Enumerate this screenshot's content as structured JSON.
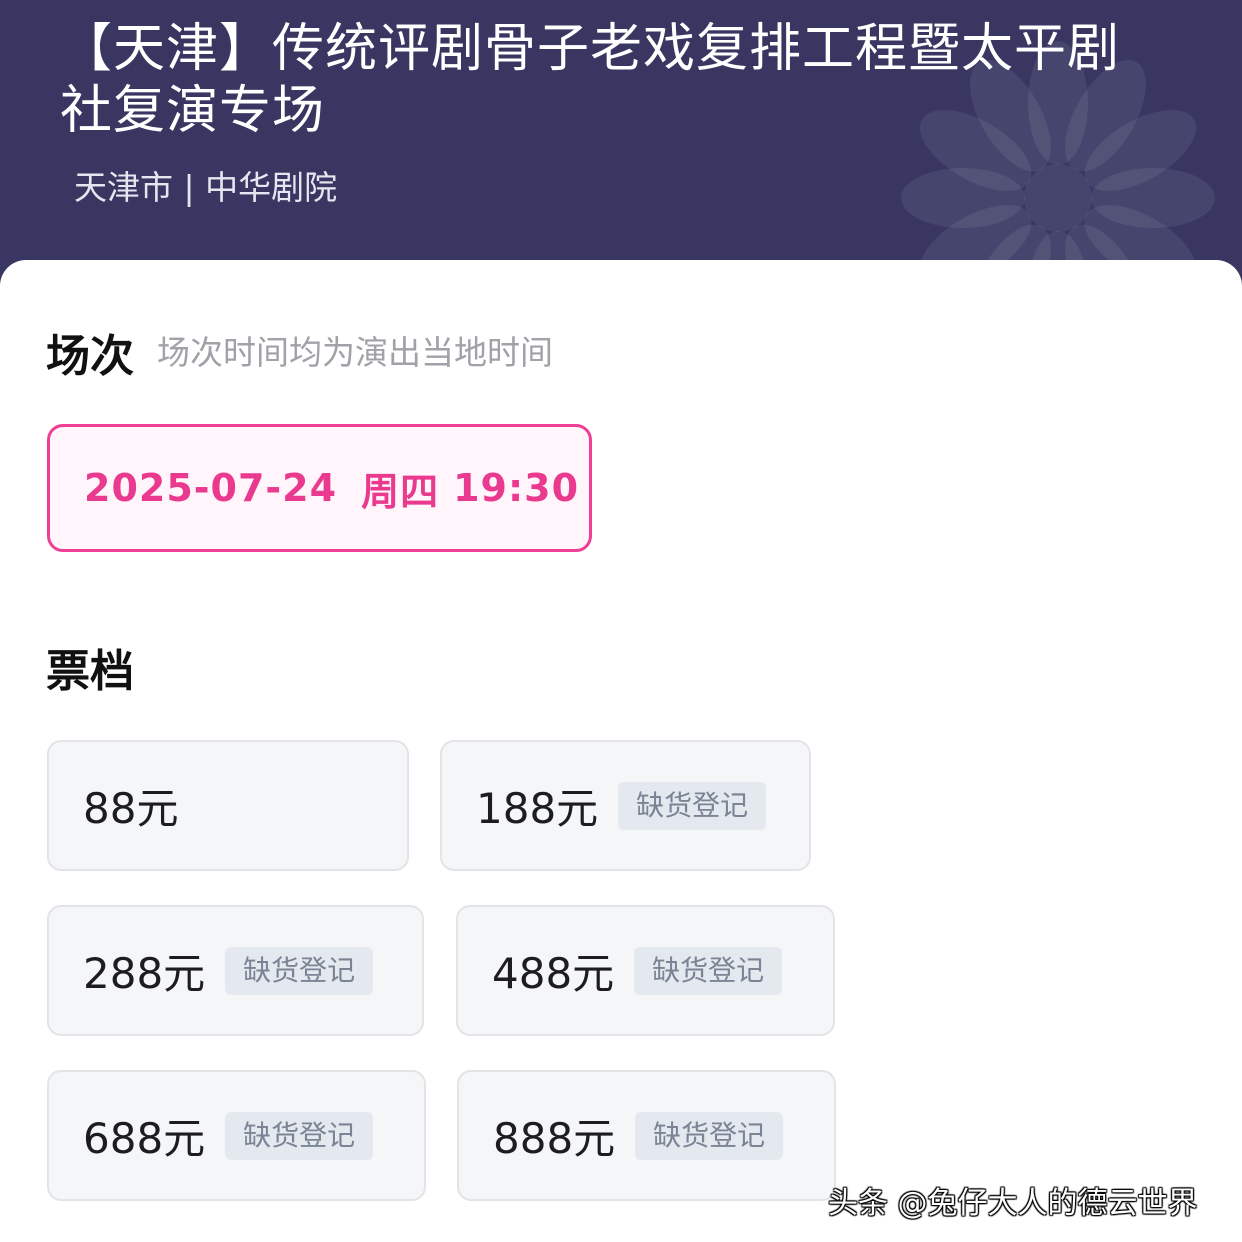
{
  "header": {
    "title": "【天津】传统评剧骨子老戏复排工程暨太平剧社复演专场",
    "venue": "天津市 | 中华剧院",
    "background_color": "#393762"
  },
  "sessions": {
    "heading": "场次",
    "note": "场次时间均为演出当地时间",
    "selected": {
      "date": "2025-07-24",
      "weekday": "周四",
      "time": "19:30"
    },
    "accent_color": "#ea3a8f"
  },
  "tickets": {
    "heading": "票档",
    "tiers": [
      {
        "price": "88元",
        "badge": ""
      },
      {
        "price": "188元",
        "badge": "缺货登记"
      },
      {
        "price": "288元",
        "badge": "缺货登记"
      },
      {
        "price": "488元",
        "badge": "缺货登记"
      },
      {
        "price": "688元",
        "badge": "缺货登记"
      },
      {
        "price": "888元",
        "badge": "缺货登记"
      }
    ]
  },
  "watermark": "头条 @兔仔大人的德云世界"
}
